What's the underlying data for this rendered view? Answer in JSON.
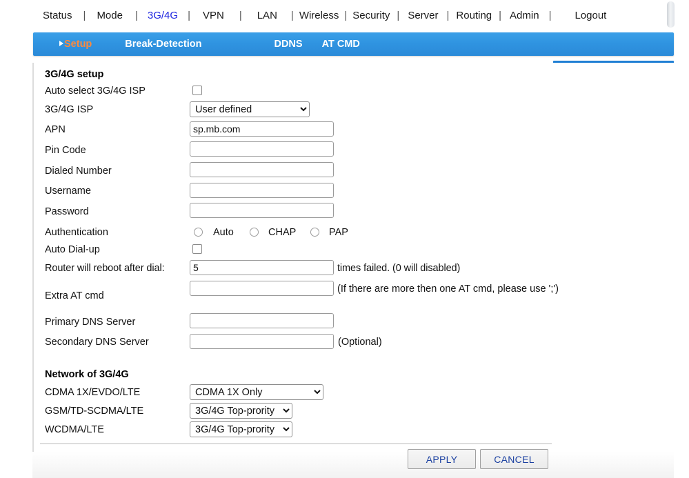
{
  "nav": {
    "items": [
      {
        "label": "Status",
        "active": false
      },
      {
        "label": "Mode",
        "active": false
      },
      {
        "label": "3G/4G",
        "active": true
      },
      {
        "label": "VPN",
        "active": false
      },
      {
        "label": "LAN",
        "active": false
      },
      {
        "label": "Wireless",
        "active": false
      },
      {
        "label": "Security",
        "active": false
      },
      {
        "label": "Server",
        "active": false
      },
      {
        "label": "Routing",
        "active": false
      },
      {
        "label": "Admin",
        "active": false
      },
      {
        "label": "Logout",
        "active": false
      }
    ],
    "separator": "|"
  },
  "tabs": [
    {
      "label": "Setup",
      "current": true
    },
    {
      "label": "Break-Detection",
      "current": false
    },
    {
      "label": "DDNS",
      "current": false
    },
    {
      "label": "AT CMD",
      "current": false
    }
  ],
  "setup": {
    "title": "3G/4G setup",
    "auto_select_label": "Auto select 3G/4G ISP",
    "auto_select_checked": false,
    "isp_label": "3G/4G ISP",
    "isp_value": "User defined",
    "isp_options": [
      "User defined"
    ],
    "apn_label": "APN",
    "apn_value": "sp.mb.com",
    "pin_label": "Pin Code",
    "pin_value": "",
    "dialed_label": "Dialed Number",
    "dialed_value": "",
    "username_label": "Username",
    "username_value": "",
    "password_label": "Password",
    "password_value": "",
    "auth_label": "Authentication",
    "auth_options": [
      {
        "label": "Auto",
        "selected": false
      },
      {
        "label": "CHAP",
        "selected": false
      },
      {
        "label": "PAP",
        "selected": false
      }
    ],
    "autodial_label": "Auto Dial-up",
    "autodial_checked": false,
    "reboot_label": "Router will reboot after dial:",
    "reboot_value": "5",
    "reboot_hint": "times failed. (0 will disabled)",
    "atcmd_label": "Extra AT cmd",
    "atcmd_value": "",
    "atcmd_hint": "(If there are more then one AT cmd, please use ';')",
    "dns1_label": "Primary DNS Server",
    "dns1_value": "",
    "dns2_label": "Secondary DNS Server",
    "dns2_value": "",
    "dns2_hint": "(Optional)"
  },
  "network": {
    "title": "Network of 3G/4G",
    "cdma_label": "CDMA 1X/EVDO/LTE",
    "cdma_value": "CDMA 1X Only",
    "cdma_options": [
      "CDMA 1X Only"
    ],
    "gsm_label": "GSM/TD-SCDMA/LTE",
    "gsm_value": "3G/4G Top-prority",
    "gsm_options": [
      "3G/4G Top-prority"
    ],
    "wcdma_label": "WCDMA/LTE",
    "wcdma_value": "3G/4G Top-prority",
    "wcdma_options": [
      "3G/4G Top-prority"
    ]
  },
  "footer": {
    "apply_label": "APPLY",
    "cancel_label": "CANCEL"
  },
  "colors": {
    "nav_active": "#1f27e0",
    "tab_current": "#ff8a3d",
    "tab_strip": "#2f93e0",
    "button_text": "#1a3fa0"
  }
}
